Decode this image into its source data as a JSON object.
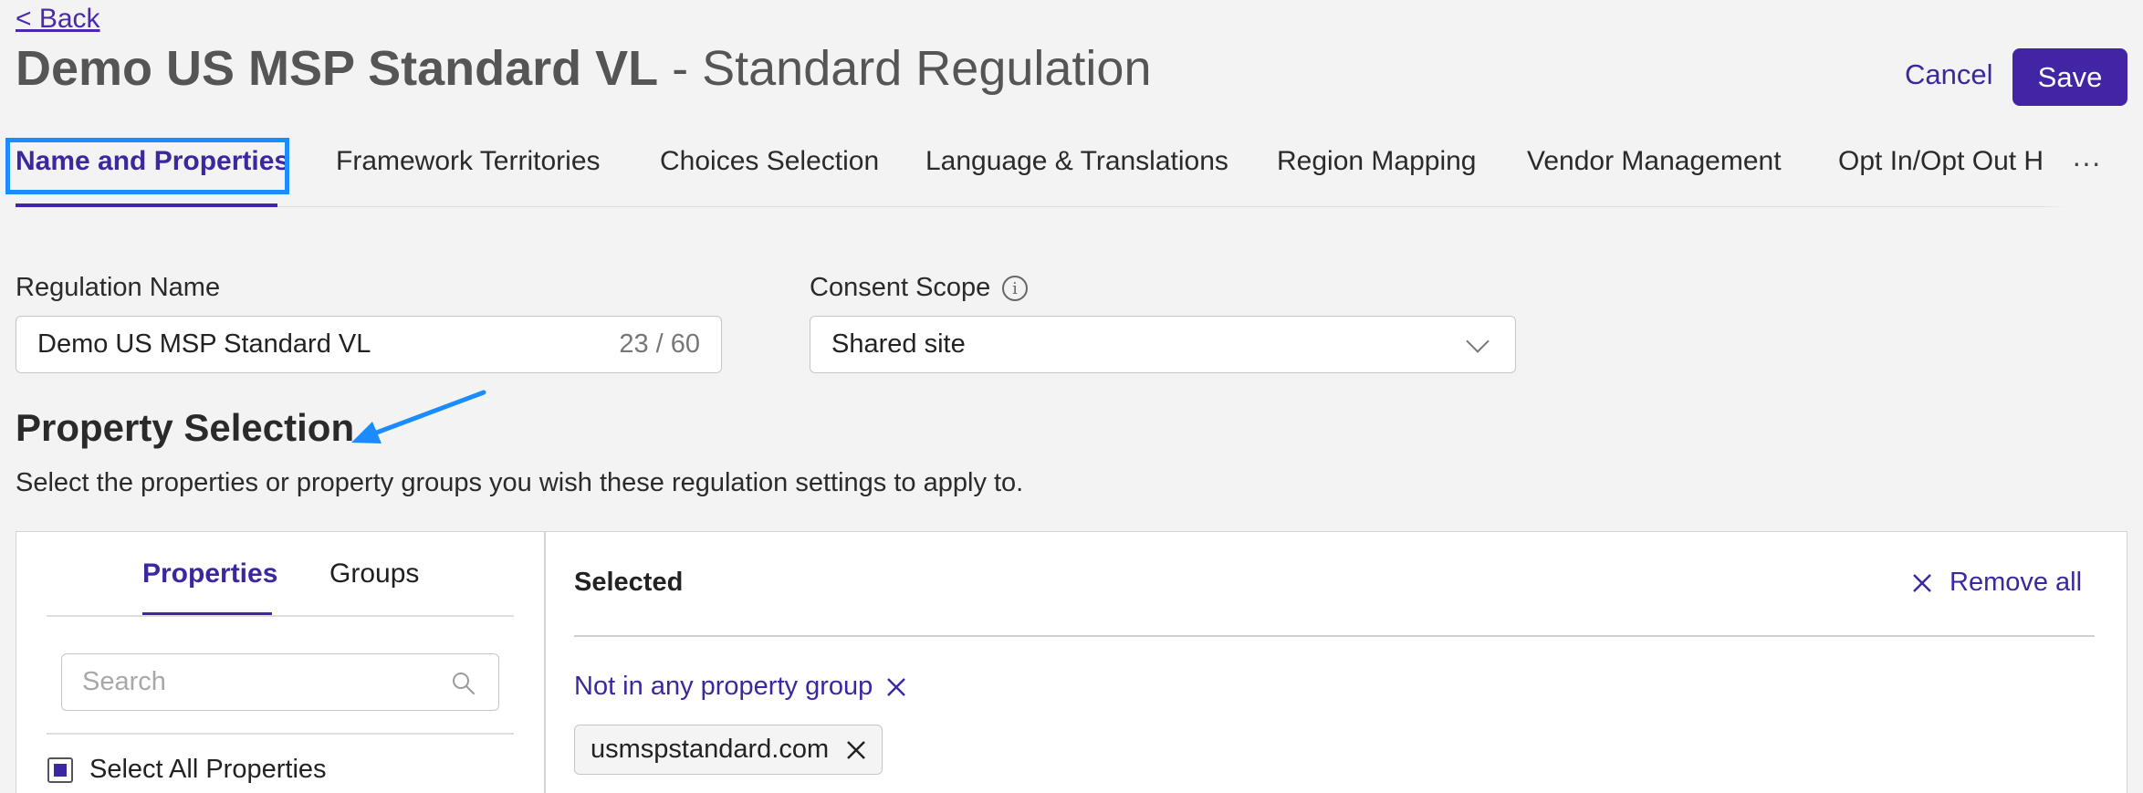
{
  "header": {
    "back_label": "< Back",
    "title_bold": "Demo US MSP Standard VL",
    "title_rest": " - Standard Regulation",
    "cancel_label": "Cancel",
    "save_label": "Save"
  },
  "tabs": [
    {
      "label": "Name and Properties",
      "active": true
    },
    {
      "label": "Framework Territories"
    },
    {
      "label": "Choices Selection"
    },
    {
      "label": "Language & Translations"
    },
    {
      "label": "Region Mapping"
    },
    {
      "label": "Vendor Management"
    },
    {
      "label": "Opt In/Opt Out H"
    }
  ],
  "tabs_more_label": "···",
  "form": {
    "regulation_name_label": "Regulation Name",
    "regulation_name_value": "Demo US MSP Standard VL",
    "regulation_name_count": "23 / 60",
    "consent_scope_label": "Consent Scope",
    "consent_scope_value": "Shared site"
  },
  "property_selection": {
    "heading": "Property Selection",
    "description": "Select the properties or property groups you wish these regulation settings to apply to.",
    "panel_tabs": [
      {
        "label": "Properties",
        "active": true
      },
      {
        "label": "Groups"
      }
    ],
    "search_placeholder": "Search",
    "select_all_label": "Select All Properties",
    "select_all_state": "indeterminate",
    "selected_title": "Selected",
    "remove_all_label": "Remove all",
    "group_label": "Not in any property group",
    "chips": [
      "usmspstandard.com"
    ]
  },
  "colors": {
    "accent": "#4125a4",
    "highlight_box": "#1a8cff",
    "arrow": "#1a8cff",
    "background": "#f3f3f3"
  }
}
